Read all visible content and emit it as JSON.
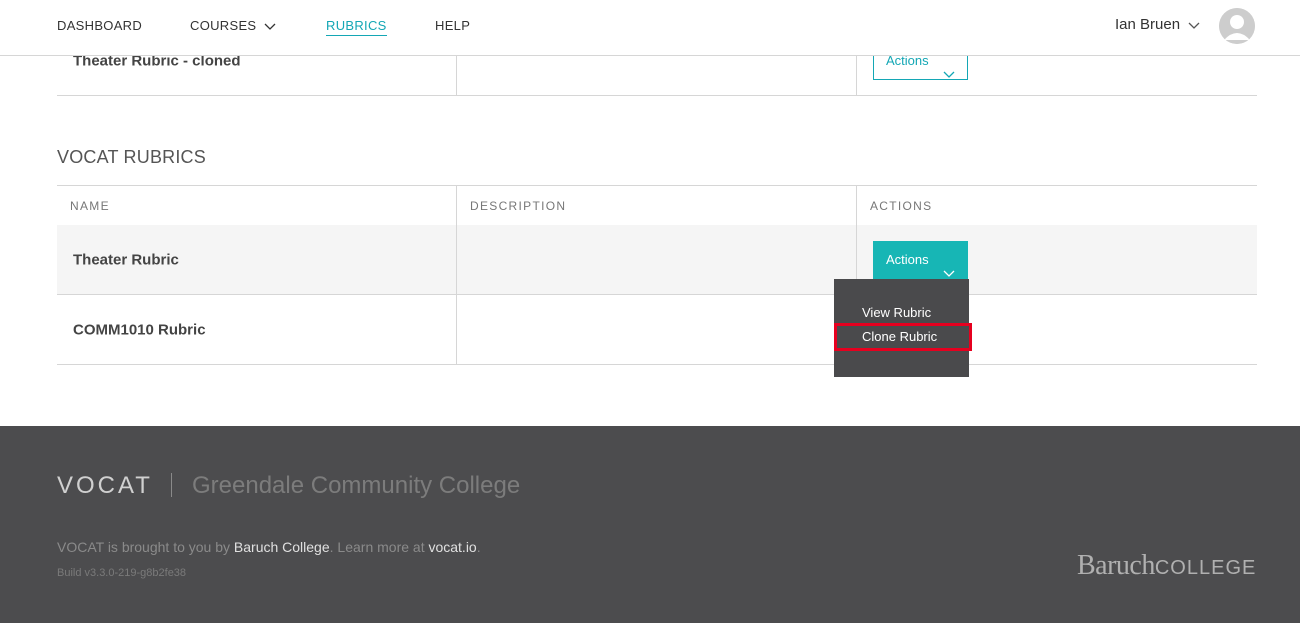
{
  "nav": {
    "items": [
      {
        "label": "DASHBOARD"
      },
      {
        "label": "COURSES"
      },
      {
        "label": "RUBRICS"
      },
      {
        "label": "HELP"
      }
    ],
    "active": "RUBRICS",
    "user_name": "Ian Bruen",
    "accent_color": "#14a7b5"
  },
  "my_rubrics": {
    "rows": [
      {
        "name": "Theater Rubric - cloned",
        "description": "",
        "action_label": "Actions"
      }
    ]
  },
  "vocat_rubrics": {
    "title": "VOCAT RUBRICS",
    "columns": [
      "NAME",
      "DESCRIPTION",
      "ACTIONS"
    ],
    "rows": [
      {
        "name": "Theater Rubric",
        "description": "",
        "action_label": "Actions"
      },
      {
        "name": "COMM1010 Rubric",
        "description": ""
      }
    ]
  },
  "dropdown": {
    "items": [
      {
        "label": "View Rubric"
      },
      {
        "label": "Clone Rubric"
      }
    ],
    "highlight_color": "#e6001f"
  },
  "footer": {
    "logo": "VOCAT",
    "college_name": "Greendale Community College",
    "tagline_prefix": "VOCAT is brought to you by ",
    "tagline_link1": "Baruch College",
    "tagline_middle": ". Learn more at ",
    "tagline_link2": "vocat.io",
    "tagline_suffix": ".",
    "build": "Build v3.3.0-219-g8b2fe38",
    "baruch_logo_part1": "Baruch",
    "baruch_logo_part2": "COLLEGE"
  }
}
